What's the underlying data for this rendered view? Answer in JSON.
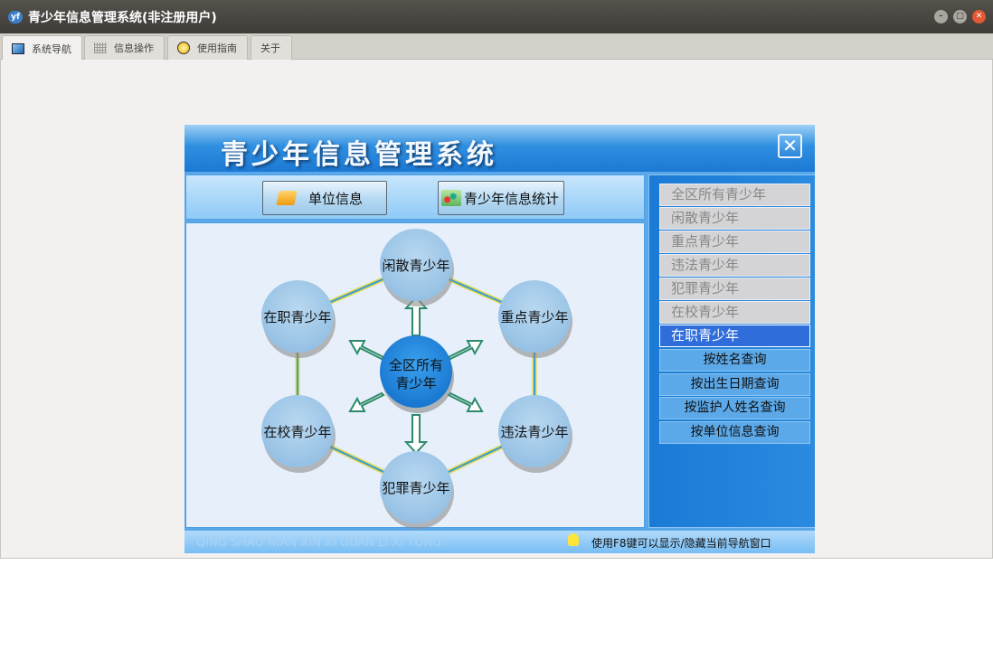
{
  "window": {
    "title": "青少年信息管理系统(非注册用户)",
    "app_icon": "yf-logo"
  },
  "tabs": [
    {
      "label": "系统导航",
      "icon": "monitor-icon"
    },
    {
      "label": "信息操作",
      "icon": "grid-icon"
    },
    {
      "label": "使用指南",
      "icon": "help-icon"
    },
    {
      "label": "关于"
    }
  ],
  "panel": {
    "title": "青少年信息管理系统",
    "buttons": {
      "unit_info": "单位信息",
      "stats": "青少年信息统计"
    },
    "diagram": {
      "center": "全区所有青少年",
      "center_line1": "全区所有",
      "center_line2": "青少年",
      "nodes": [
        "闲散青少年",
        "重点青少年",
        "违法青少年",
        "犯罪青少年",
        "在校青少年",
        "在职青少年"
      ]
    },
    "categories": [
      "全区所有青少年",
      "闲散青少年",
      "重点青少年",
      "违法青少年",
      "犯罪青少年",
      "在校青少年",
      "在职青少年"
    ],
    "selected_category": "在职青少年",
    "queries": [
      "按姓名查询",
      "按出生日期查询",
      "按监护人姓名查询",
      "按单位信息查询"
    ],
    "footer": {
      "pinyin": "QING SHAO NIAN XIN XI GUAN LI XI TONG",
      "tip": "使用F8键可以显示/隐藏当前导航窗口"
    }
  }
}
